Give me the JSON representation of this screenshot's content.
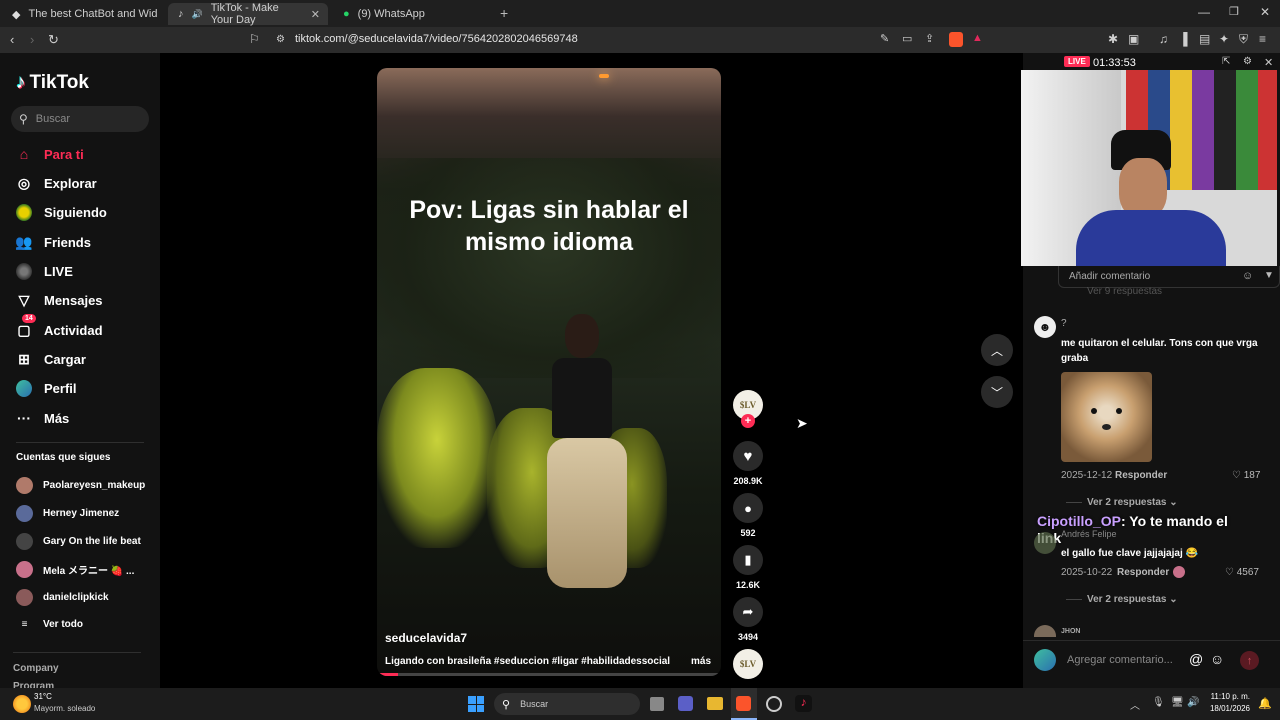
{
  "browser": {
    "tabs": [
      {
        "label": "The best ChatBot and Widgets for Ki"
      },
      {
        "label": "TikTok - Make Your Day"
      },
      {
        "label": "(9) WhatsApp"
      }
    ],
    "url": "tiktok.com/@seducelavida7/video/7564202802046569748"
  },
  "sidebar": {
    "logo": "TikTok",
    "search_placeholder": "Buscar",
    "nav": [
      {
        "label": "Para ti",
        "active": true
      },
      {
        "label": "Explorar"
      },
      {
        "label": "Siguiendo"
      },
      {
        "label": "Friends"
      },
      {
        "label": "LIVE"
      },
      {
        "label": "Mensajes"
      },
      {
        "label": "Actividad",
        "badge": "14"
      },
      {
        "label": "Cargar"
      },
      {
        "label": "Perfil"
      },
      {
        "label": "Más"
      }
    ],
    "following_title": "Cuentas que sigues",
    "following": [
      "Paolareyesn_makeup",
      "Herney Jimenez",
      "Gary On the life beat",
      "Mela メラニー 🍓 ...",
      "danielclipkick"
    ],
    "see_all": "Ver todo",
    "company": "Company",
    "program": "Program"
  },
  "video": {
    "caption_overlay": "Pov: Ligas sin hablar el mismo idioma",
    "author": "seducelavida7",
    "description": "Ligando con brasileña #seduccion #ligar #habilidadessociales ...",
    "more": "más",
    "avatar_text": "$LV",
    "likes": "208.9K",
    "comments": "592",
    "saves": "12.6K",
    "shares": "3494"
  },
  "stream": {
    "live_badge": "LIVE",
    "timer": "01:33:53",
    "overlay_name": "Cipotillo_OP",
    "overlay_msg": ": Yo te mando el link"
  },
  "comments": {
    "input_placeholder_top": "Añadir comentario",
    "replies_top": "Ver 9 respuestas",
    "items": [
      {
        "user": "?",
        "text": "me quitaron el celular. Tons con que vrga graba",
        "date": "2025-12-12",
        "reply": "Responder",
        "likes": "187",
        "replies": "Ver 2 respuestas"
      },
      {
        "user": "Andrés Felipe",
        "text": "el gallo fue clave jajjajajaj 😂",
        "date": "2025-10-22",
        "reply": "Responder",
        "likes": "4567",
        "replies": "Ver 2 respuestas"
      },
      {
        "user": "JHON"
      }
    ],
    "add_placeholder": "Agregar comentario..."
  },
  "taskbar": {
    "weather_temp": "31°C",
    "weather_desc": "Mayorm. soleado",
    "search": "Buscar",
    "time": "11:10 p. m.",
    "date": "18/01/2026"
  },
  "colors": {
    "accent": "#fe2c55",
    "panel": "#121212",
    "sidebar": "#121212"
  }
}
